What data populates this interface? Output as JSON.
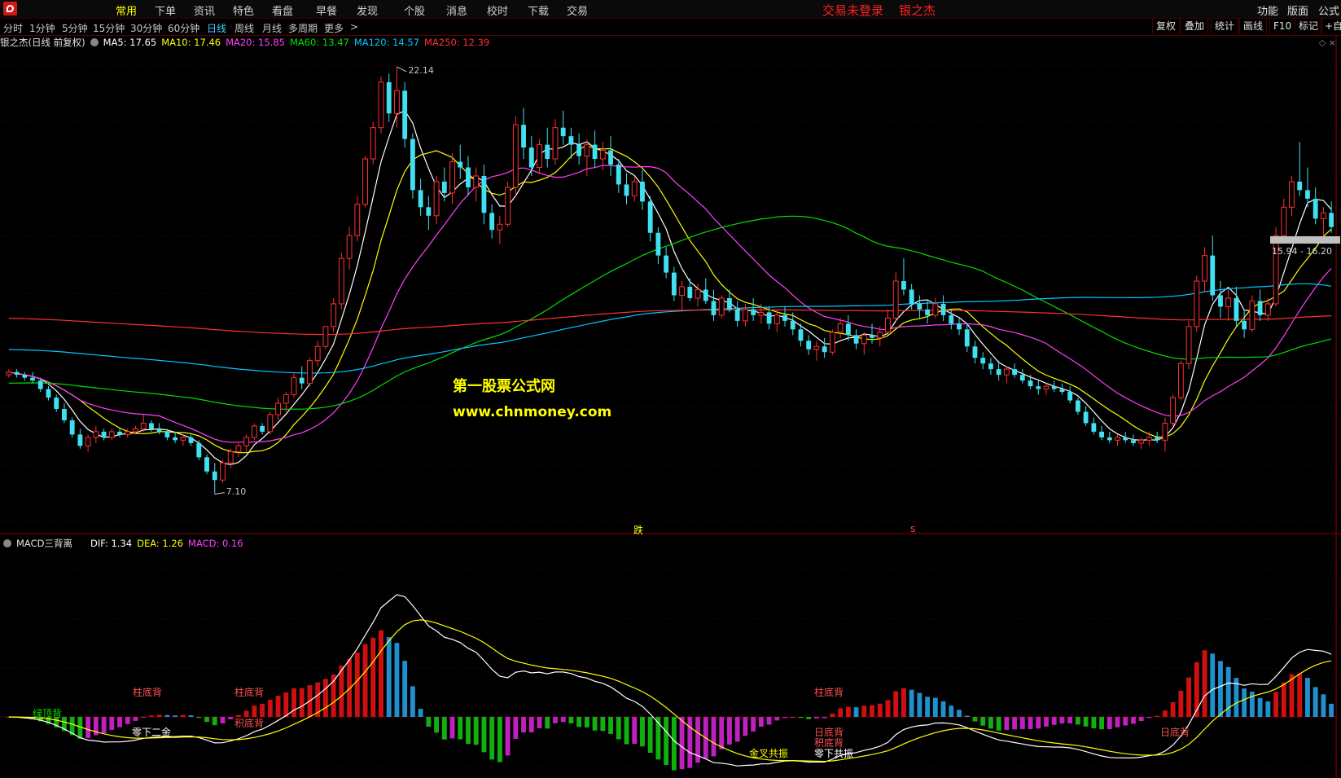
{
  "menubar": {
    "items": [
      "常用",
      "下单",
      "资讯",
      "特色",
      "看盘",
      "早餐",
      "发现",
      "个股",
      "消息",
      "校时",
      "下载",
      "交易"
    ],
    "active_index": 0,
    "status": "交易未登录",
    "user": "银之杰",
    "right_items": [
      "功能",
      "版面",
      "公式"
    ]
  },
  "periodbar": {
    "periods": [
      "分时",
      "1分钟",
      "5分钟",
      "15分钟",
      "30分钟",
      "60分钟",
      "日线",
      "周线",
      "月线",
      "多周期",
      "更多"
    ],
    "active_index": 6,
    "tools": [
      "复权",
      "叠加",
      "统计",
      "画线",
      "F10",
      "标记",
      "+自"
    ]
  },
  "main_legend": {
    "title": "银之杰(日线 前复权)",
    "ma": [
      {
        "label": "MA5: 17.65",
        "color": "#ffffff"
      },
      {
        "label": "MA10: 17.46",
        "color": "#ffff00"
      },
      {
        "label": "MA20: 15.85",
        "color": "#ff40ff"
      },
      {
        "label": "MA60: 13.47",
        "color": "#00e000"
      },
      {
        "label": "MA120: 14.57",
        "color": "#00c8ff"
      },
      {
        "label": "MA250: 12.39",
        "color": "#ff3030"
      }
    ]
  },
  "price_labels": {
    "high": "22.14",
    "low": "7.10",
    "last": "15.94 - 16.20"
  },
  "markers": {
    "fall": "跌",
    "s": "s"
  },
  "watermark": {
    "line1": "第一股票公式网",
    "line2": "www.chnmoney.com"
  },
  "sub_legend": {
    "title": "MACD三背离",
    "items": [
      {
        "label": "DIF: 1.34",
        "color": "#ffffff"
      },
      {
        "label": "DEA: 1.26",
        "color": "#ffff00"
      },
      {
        "label": "MACD: 0.16",
        "color": "#ff40ff"
      }
    ]
  },
  "annotations": [
    {
      "text": "绿顶背",
      "color": "#00e000",
      "x": 40,
      "y": 879
    },
    {
      "text": "零下二金",
      "color": "#ffffff",
      "x": 162,
      "y": 902
    },
    {
      "text": "柱底背",
      "color": "#ff5050",
      "x": 163,
      "y": 853
    },
    {
      "text": "柱底背",
      "color": "#ff5050",
      "x": 288,
      "y": 853
    },
    {
      "text": "积底背",
      "color": "#ff5050",
      "x": 288,
      "y": 891
    },
    {
      "text": "柱底背",
      "color": "#ff5050",
      "x": 1000,
      "y": 853
    },
    {
      "text": "日底背",
      "color": "#ff5050",
      "x": 1000,
      "y": 902
    },
    {
      "text": "积底背",
      "color": "#ff5050",
      "x": 1000,
      "y": 915
    },
    {
      "text": "零下共振",
      "color": "#ffffff",
      "x": 1000,
      "y": 928
    },
    {
      "text": "金叉共振",
      "color": "#ffff00",
      "x": 920,
      "y": 928
    },
    {
      "text": "日底背",
      "color": "#ff5050",
      "x": 1425,
      "y": 902
    }
  ],
  "chart_data": {
    "type": "candlestick",
    "panel": "price",
    "period": "日线",
    "adjust": "前复权",
    "ohlc": [
      [
        11.3,
        11.5,
        11.2,
        11.4
      ],
      [
        11.4,
        11.5,
        11.2,
        11.3
      ],
      [
        11.3,
        11.4,
        11.1,
        11.2
      ],
      [
        11.2,
        11.4,
        11.0,
        11.1
      ],
      [
        11.1,
        11.2,
        10.7,
        10.8
      ],
      [
        10.8,
        10.9,
        10.4,
        10.5
      ],
      [
        10.5,
        10.6,
        10.0,
        10.1
      ],
      [
        10.1,
        10.3,
        9.6,
        9.7
      ],
      [
        9.7,
        9.8,
        9.1,
        9.2
      ],
      [
        9.2,
        9.4,
        8.7,
        8.8
      ],
      [
        8.8,
        9.2,
        8.6,
        9.1
      ],
      [
        9.1,
        9.5,
        8.9,
        9.3
      ],
      [
        9.3,
        9.4,
        9.0,
        9.1
      ],
      [
        9.1,
        9.4,
        9.0,
        9.3
      ],
      [
        9.3,
        9.4,
        9.1,
        9.2
      ],
      [
        9.2,
        9.4,
        9.1,
        9.3
      ],
      [
        9.3,
        9.5,
        9.2,
        9.4
      ],
      [
        9.4,
        9.9,
        9.3,
        9.6
      ],
      [
        9.6,
        9.7,
        9.3,
        9.4
      ],
      [
        9.4,
        9.6,
        9.2,
        9.3
      ],
      [
        9.3,
        9.4,
        9.0,
        9.1
      ],
      [
        9.1,
        9.3,
        8.9,
        9.0
      ],
      [
        9.0,
        9.2,
        8.8,
        9.1
      ],
      [
        9.1,
        9.2,
        8.8,
        8.9
      ],
      [
        8.9,
        9.0,
        8.3,
        8.4
      ],
      [
        8.4,
        8.5,
        7.8,
        7.9
      ],
      [
        7.9,
        8.2,
        7.1,
        7.6
      ],
      [
        7.6,
        8.3,
        7.5,
        8.2
      ],
      [
        8.2,
        8.7,
        8.0,
        8.6
      ],
      [
        8.6,
        8.9,
        8.4,
        8.8
      ],
      [
        8.8,
        9.2,
        8.6,
        9.1
      ],
      [
        9.1,
        9.6,
        9.0,
        9.5
      ],
      [
        9.5,
        9.6,
        9.2,
        9.3
      ],
      [
        9.3,
        10.0,
        9.2,
        9.9
      ],
      [
        9.9,
        10.5,
        9.7,
        10.3
      ],
      [
        10.3,
        10.7,
        10.0,
        10.6
      ],
      [
        10.6,
        11.4,
        10.5,
        11.2
      ],
      [
        11.2,
        11.6,
        10.8,
        11.0
      ],
      [
        11.0,
        11.9,
        10.9,
        11.8
      ],
      [
        11.8,
        12.5,
        11.6,
        12.3
      ],
      [
        12.3,
        13.0,
        12.2,
        13.0
      ],
      [
        13.0,
        14.0,
        12.8,
        13.8
      ],
      [
        13.8,
        15.6,
        13.6,
        15.4
      ],
      [
        15.4,
        16.5,
        15.0,
        16.2
      ],
      [
        16.2,
        17.6,
        16.0,
        17.3
      ],
      [
        17.3,
        19.0,
        17.2,
        18.9
      ],
      [
        18.9,
        20.2,
        18.7,
        20.0
      ],
      [
        20.0,
        21.8,
        19.8,
        21.6
      ],
      [
        21.6,
        21.9,
        20.2,
        20.5
      ],
      [
        20.5,
        22.14,
        20.0,
        21.3
      ],
      [
        21.3,
        21.6,
        19.3,
        19.6
      ],
      [
        19.6,
        19.8,
        17.5,
        17.8
      ],
      [
        17.8,
        18.2,
        16.9,
        17.2
      ],
      [
        17.2,
        17.6,
        16.4,
        16.9
      ],
      [
        16.9,
        18.3,
        16.6,
        18.1
      ],
      [
        18.1,
        18.6,
        17.4,
        17.7
      ],
      [
        17.7,
        19.1,
        17.3,
        18.8
      ],
      [
        18.8,
        19.4,
        18.2,
        18.6
      ],
      [
        18.6,
        19.0,
        17.6,
        17.9
      ],
      [
        17.9,
        18.6,
        17.4,
        18.3
      ],
      [
        18.3,
        18.7,
        16.6,
        17.0
      ],
      [
        17.0,
        17.3,
        16.1,
        16.4
      ],
      [
        16.4,
        16.9,
        15.9,
        16.6
      ],
      [
        16.6,
        18.1,
        16.5,
        17.9
      ],
      [
        17.9,
        20.4,
        17.6,
        20.1
      ],
      [
        20.1,
        20.7,
        18.9,
        19.3
      ],
      [
        19.3,
        19.7,
        18.3,
        18.6
      ],
      [
        18.6,
        19.6,
        18.4,
        19.4
      ],
      [
        19.4,
        20.0,
        18.6,
        18.9
      ],
      [
        18.9,
        20.3,
        18.7,
        20.0
      ],
      [
        20.0,
        20.6,
        19.4,
        19.7
      ],
      [
        19.7,
        20.0,
        18.9,
        19.4
      ],
      [
        19.4,
        19.8,
        18.7,
        19.0
      ],
      [
        19.0,
        19.6,
        18.3,
        19.4
      ],
      [
        19.4,
        19.9,
        18.6,
        18.9
      ],
      [
        18.9,
        19.5,
        18.5,
        19.2
      ],
      [
        19.2,
        19.7,
        18.3,
        18.7
      ],
      [
        18.7,
        18.9,
        17.7,
        18.0
      ],
      [
        18.0,
        18.4,
        17.3,
        17.6
      ],
      [
        17.6,
        18.3,
        17.4,
        18.1
      ],
      [
        18.1,
        18.5,
        17.1,
        17.4
      ],
      [
        17.4,
        17.6,
        16.0,
        16.3
      ],
      [
        16.3,
        16.5,
        15.2,
        15.5
      ],
      [
        15.5,
        15.8,
        14.7,
        14.9
      ],
      [
        14.9,
        15.1,
        13.9,
        14.1
      ],
      [
        14.1,
        14.6,
        13.6,
        14.4
      ],
      [
        14.4,
        14.7,
        13.9,
        14.0
      ],
      [
        14.0,
        14.5,
        13.7,
        14.3
      ],
      [
        14.3,
        14.7,
        13.8,
        13.9
      ],
      [
        13.9,
        14.3,
        13.2,
        13.4
      ],
      [
        13.4,
        14.1,
        13.3,
        14.0
      ],
      [
        14.0,
        14.3,
        13.5,
        13.6
      ],
      [
        13.6,
        13.9,
        13.0,
        13.2
      ],
      [
        13.2,
        13.8,
        13.0,
        13.6
      ],
      [
        13.6,
        14.0,
        13.2,
        13.4
      ],
      [
        13.4,
        13.8,
        13.1,
        13.5
      ],
      [
        13.5,
        13.7,
        12.9,
        13.1
      ],
      [
        13.1,
        13.6,
        12.8,
        13.4
      ],
      [
        13.4,
        13.7,
        13.0,
        13.2
      ],
      [
        13.2,
        13.5,
        12.7,
        12.9
      ],
      [
        12.9,
        13.1,
        12.3,
        12.5
      ],
      [
        12.5,
        12.7,
        12.0,
        12.2
      ],
      [
        12.2,
        12.5,
        11.8,
        12.3
      ],
      [
        12.3,
        12.6,
        11.9,
        12.1
      ],
      [
        12.1,
        12.9,
        12.0,
        12.8
      ],
      [
        12.8,
        13.3,
        12.6,
        13.1
      ],
      [
        13.1,
        13.4,
        12.5,
        12.7
      ],
      [
        12.7,
        12.9,
        12.2,
        12.4
      ],
      [
        12.4,
        12.8,
        12.0,
        12.7
      ],
      [
        12.7,
        13.1,
        12.4,
        12.6
      ],
      [
        12.6,
        13.0,
        12.3,
        12.8
      ],
      [
        12.8,
        13.6,
        12.7,
        13.3
      ],
      [
        13.3,
        14.9,
        13.2,
        14.6
      ],
      [
        14.6,
        15.4,
        14.1,
        14.3
      ],
      [
        14.3,
        14.5,
        13.6,
        13.8
      ],
      [
        13.8,
        14.1,
        13.3,
        13.6
      ],
      [
        13.6,
        13.9,
        13.1,
        13.4
      ],
      [
        13.4,
        14.0,
        13.3,
        13.8
      ],
      [
        13.8,
        14.1,
        13.2,
        13.4
      ],
      [
        13.4,
        13.6,
        12.9,
        13.1
      ],
      [
        13.1,
        13.3,
        12.7,
        12.9
      ],
      [
        12.9,
        13.1,
        12.1,
        12.3
      ],
      [
        12.3,
        12.5,
        11.7,
        11.9
      ],
      [
        11.9,
        12.1,
        11.5,
        11.7
      ],
      [
        11.7,
        11.9,
        11.3,
        11.5
      ],
      [
        11.5,
        11.8,
        11.1,
        11.3
      ],
      [
        11.3,
        11.6,
        11.0,
        11.5
      ],
      [
        11.5,
        11.7,
        11.2,
        11.3
      ],
      [
        11.3,
        11.5,
        11.0,
        11.1
      ],
      [
        11.1,
        11.3,
        10.8,
        10.9
      ],
      [
        10.9,
        11.1,
        10.6,
        10.8
      ],
      [
        10.8,
        11.0,
        10.6,
        10.9
      ],
      [
        10.9,
        11.1,
        10.7,
        10.8
      ],
      [
        10.8,
        11.0,
        10.6,
        10.7
      ],
      [
        10.7,
        10.9,
        10.3,
        10.4
      ],
      [
        10.4,
        10.5,
        9.9,
        10.0
      ],
      [
        10.0,
        10.2,
        9.5,
        9.6
      ],
      [
        9.6,
        9.8,
        9.2,
        9.3
      ],
      [
        9.3,
        9.5,
        9.0,
        9.1
      ],
      [
        9.1,
        9.3,
        8.9,
        9.0
      ],
      [
        9.0,
        9.2,
        8.8,
        9.1
      ],
      [
        9.1,
        9.3,
        8.9,
        9.0
      ],
      [
        9.0,
        9.2,
        8.8,
        8.9
      ],
      [
        8.9,
        9.1,
        8.7,
        9.0
      ],
      [
        9.0,
        9.3,
        8.8,
        9.1
      ],
      [
        9.1,
        9.3,
        8.9,
        9.0
      ],
      [
        9.0,
        9.8,
        8.6,
        9.6
      ],
      [
        9.6,
        10.6,
        9.5,
        10.5
      ],
      [
        10.5,
        11.8,
        10.4,
        11.7
      ],
      [
        11.7,
        13.2,
        11.5,
        13.0
      ],
      [
        13.0,
        14.8,
        12.8,
        14.6
      ],
      [
        14.6,
        15.8,
        14.2,
        15.5
      ],
      [
        15.5,
        16.2,
        13.9,
        14.1
      ],
      [
        14.1,
        14.6,
        13.3,
        13.7
      ],
      [
        13.7,
        14.3,
        13.2,
        14.0
      ],
      [
        14.0,
        14.4,
        13.0,
        13.2
      ],
      [
        13.2,
        13.6,
        12.6,
        12.9
      ],
      [
        12.9,
        14.1,
        12.8,
        13.9
      ],
      [
        13.9,
        14.3,
        13.2,
        13.4
      ],
      [
        13.4,
        14.0,
        13.2,
        13.8
      ],
      [
        13.8,
        16.5,
        13.7,
        16.2
      ],
      [
        16.2,
        17.5,
        16.0,
        17.2
      ],
      [
        17.2,
        18.3,
        16.9,
        18.1
      ],
      [
        18.1,
        19.5,
        17.6,
        17.8
      ],
      [
        17.8,
        18.6,
        17.2,
        17.5
      ],
      [
        17.5,
        17.9,
        16.6,
        16.8
      ],
      [
        16.8,
        17.2,
        16.2,
        17.0
      ],
      [
        17.0,
        17.4,
        16.3,
        16.5
      ]
    ],
    "high_label": 22.14,
    "low_label": 7.1,
    "ylim": [
      6.0,
      22.6
    ]
  }
}
